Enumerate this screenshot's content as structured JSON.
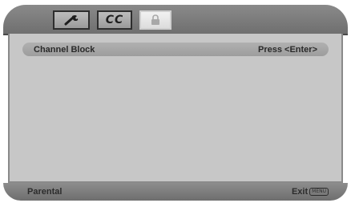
{
  "tabs": [
    {
      "name": "Setup",
      "icon": "wrench-icon"
    },
    {
      "name": "CC",
      "label": "CC"
    },
    {
      "name": "Lock",
      "icon": "lock-icon",
      "selected": true
    }
  ],
  "menu": {
    "items": [
      {
        "label": "Channel Block",
        "value": "Press <Enter>"
      }
    ]
  },
  "footer": {
    "title": "Parental",
    "exit_label": "Exit",
    "exit_key": "MENU"
  },
  "colors": {
    "panel": "#c7c7c7",
    "bar": "#7e7e7e",
    "selected_tab": "#e8e8e8"
  }
}
